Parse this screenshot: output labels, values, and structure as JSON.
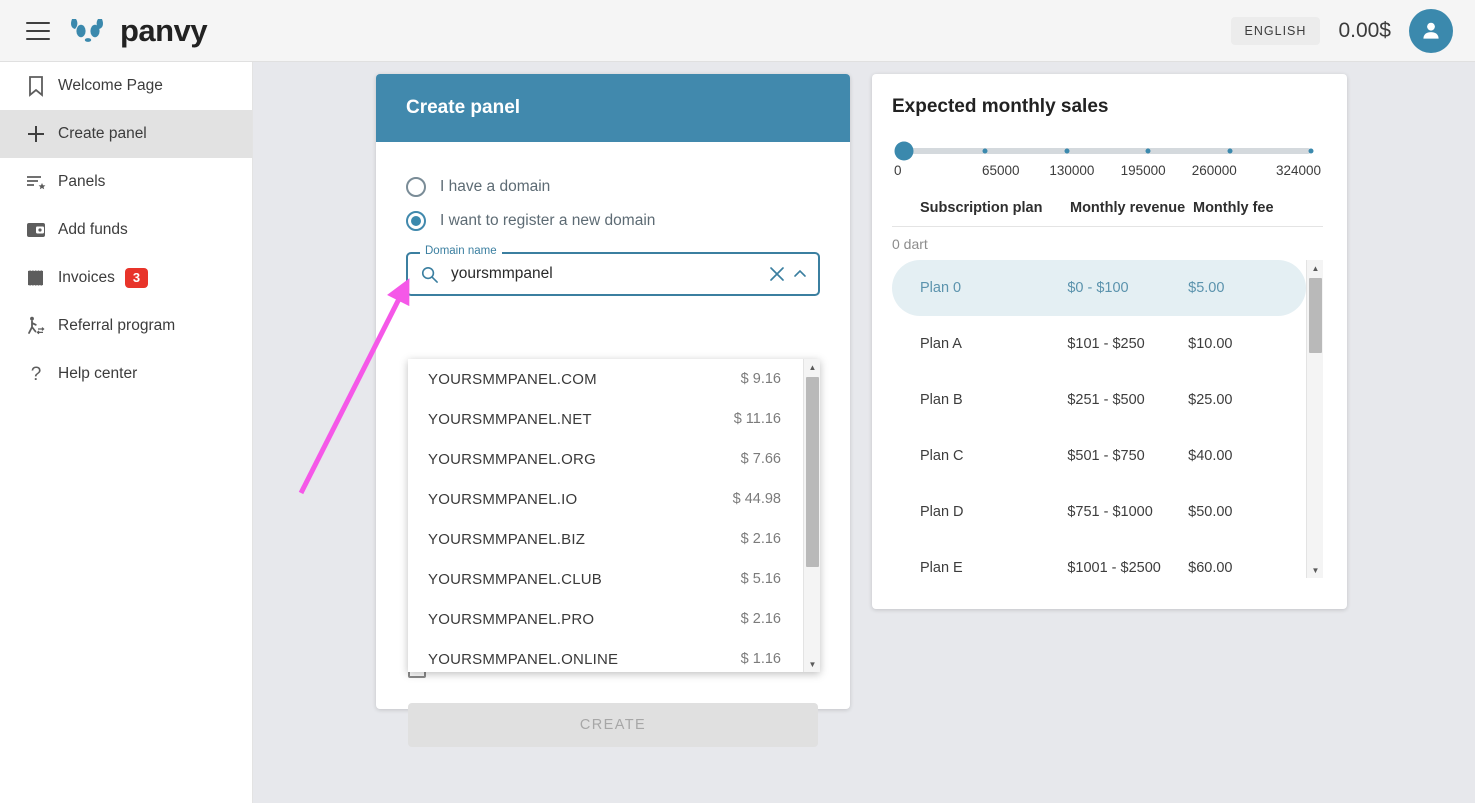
{
  "topbar": {
    "menu_icon": "hamburger-icon",
    "brand": "panvy",
    "brand_logo_icon": "panda-logo-icon",
    "language_label": "ENGLISH",
    "balance": "0.00$",
    "avatar_icon": "account-circle-icon",
    "accent_color": "#3b89ad"
  },
  "sidebar": {
    "items": [
      {
        "label": "Welcome Page",
        "icon": "bookmark-icon",
        "active": false
      },
      {
        "label": "Create panel",
        "icon": "plus-icon",
        "active": true
      },
      {
        "label": "Panels",
        "icon": "list-star-icon",
        "active": false
      },
      {
        "label": "Add funds",
        "icon": "wallet-icon",
        "active": false
      },
      {
        "label": "Invoices",
        "icon": "receipt-icon",
        "active": false,
        "badge": "3"
      },
      {
        "label": "Referral program",
        "icon": "person-walking-icon",
        "active": false
      },
      {
        "label": "Help center",
        "icon": "question-mark-icon",
        "active": false
      }
    ],
    "badge_color": "#e8342a"
  },
  "create_panel": {
    "title": "Create panel",
    "header_color": "#4189ad",
    "options": [
      {
        "label": "I have a domain",
        "selected": false
      },
      {
        "label": "I want to register a new domain",
        "selected": true
      }
    ],
    "domain_field": {
      "legend": "Domain name",
      "value": "yoursmmpanel",
      "placeholder": "Domain name",
      "search_icon": "search-icon",
      "clear_icon": "close-icon",
      "toggle_icon": "chevron-up-icon"
    },
    "suggestions": [
      {
        "domain": "YOURSMMPANEL.COM",
        "price": "$ 9.16"
      },
      {
        "domain": "YOURSMMPANEL.NET",
        "price": "$ 11.16"
      },
      {
        "domain": "YOURSMMPANEL.ORG",
        "price": "$ 7.66"
      },
      {
        "domain": "YOURSMMPANEL.IO",
        "price": "$ 44.98"
      },
      {
        "domain": "YOURSMMPANEL.BIZ",
        "price": "$ 2.16"
      },
      {
        "domain": "YOURSMMPANEL.CLUB",
        "price": "$ 5.16"
      },
      {
        "domain": "YOURSMMPANEL.PRO",
        "price": "$ 2.16"
      },
      {
        "domain": "YOURSMMPANEL.ONLINE",
        "price": "$ 1.16"
      }
    ],
    "create_button": "CREATE"
  },
  "sales": {
    "title": "Expected monthly sales",
    "dart_label": "0 dart",
    "columns": [
      "Subscription plan",
      "Monthly revenue",
      "Monthly fee"
    ],
    "rows": [
      {
        "plan": "Plan 0",
        "revenue": "$0 - $100",
        "fee": "$5.00",
        "selected": true
      },
      {
        "plan": "Plan A",
        "revenue": "$101 - $250",
        "fee": "$10.00",
        "selected": false
      },
      {
        "plan": "Plan B",
        "revenue": "$251 - $500",
        "fee": "$25.00",
        "selected": false
      },
      {
        "plan": "Plan C",
        "revenue": "$501 - $750",
        "fee": "$40.00",
        "selected": false
      },
      {
        "plan": "Plan D",
        "revenue": "$751 - $1000",
        "fee": "$50.00",
        "selected": false
      },
      {
        "plan": "Plan E",
        "revenue": "$1001 - $2500",
        "fee": "$60.00",
        "selected": false
      }
    ]
  },
  "chart_data": {
    "type": "slider",
    "title": "Expected monthly sales",
    "tick_labels": [
      "0",
      "65000",
      "130000",
      "195000",
      "260000",
      "324000"
    ],
    "values": [
      0,
      65000,
      130000,
      195000,
      260000,
      324000
    ],
    "current_value": 0,
    "xlim": [
      0,
      324000
    ],
    "xlabel": "",
    "ylabel": ""
  },
  "annotation": {
    "arrow_color": "#f558e8"
  }
}
